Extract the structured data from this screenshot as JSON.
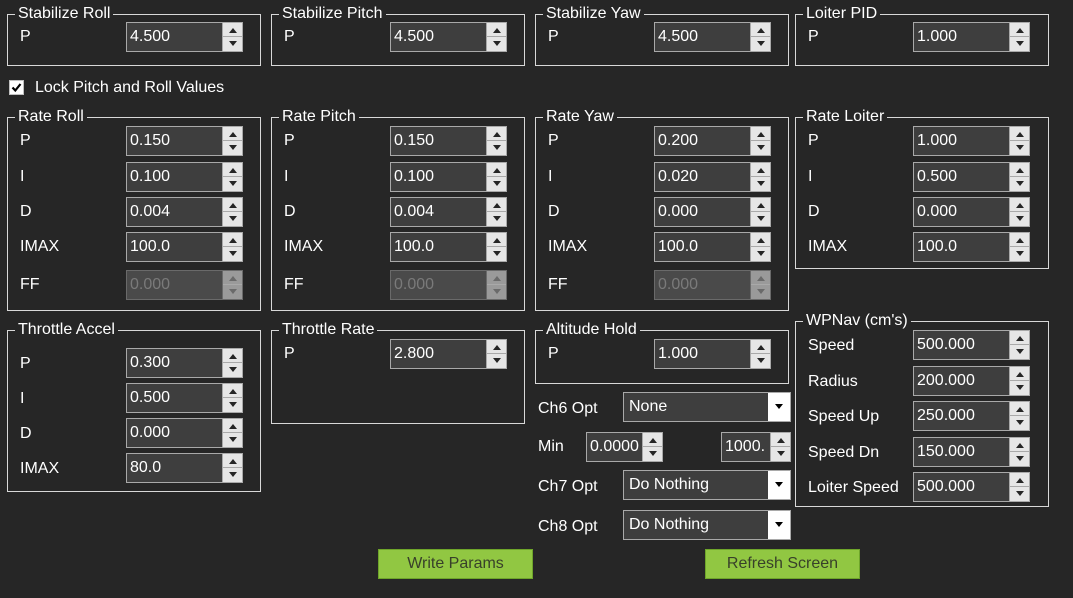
{
  "stabilize_roll": {
    "title": "Stabilize Roll",
    "p_label": "P",
    "p_value": "4.500"
  },
  "stabilize_pitch": {
    "title": "Stabilize Pitch",
    "p_label": "P",
    "p_value": "4.500"
  },
  "stabilize_yaw": {
    "title": "Stabilize Yaw",
    "p_label": "P",
    "p_value": "4.500"
  },
  "loiter_pid": {
    "title": "Loiter PID",
    "p_label": "P",
    "p_value": "1.000"
  },
  "lock_pitch_roll": {
    "label": "Lock Pitch and Roll Values",
    "checked": true
  },
  "rate_roll": {
    "title": "Rate Roll",
    "labels": {
      "p": "P",
      "i": "I",
      "d": "D",
      "imax": "IMAX",
      "ff": "FF"
    },
    "values": {
      "p": "0.150",
      "i": "0.100",
      "d": "0.004",
      "imax": "100.0",
      "ff": "0.000"
    }
  },
  "rate_pitch": {
    "title": "Rate Pitch",
    "labels": {
      "p": "P",
      "i": "I",
      "d": "D",
      "imax": "IMAX",
      "ff": "FF"
    },
    "values": {
      "p": "0.150",
      "i": "0.100",
      "d": "0.004",
      "imax": "100.0",
      "ff": "0.000"
    }
  },
  "rate_yaw": {
    "title": "Rate Yaw",
    "labels": {
      "p": "P",
      "i": "I",
      "d": "D",
      "imax": "IMAX",
      "ff": "FF"
    },
    "values": {
      "p": "0.200",
      "i": "0.020",
      "d": "0.000",
      "imax": "100.0",
      "ff": "0.000"
    }
  },
  "rate_loiter": {
    "title": "Rate Loiter",
    "labels": {
      "p": "P",
      "i": "I",
      "d": "D",
      "imax": "IMAX"
    },
    "values": {
      "p": "1.000",
      "i": "0.500",
      "d": "0.000",
      "imax": "100.0"
    }
  },
  "throttle_accel": {
    "title": "Throttle Accel",
    "labels": {
      "p": "P",
      "i": "I",
      "d": "D",
      "imax": "IMAX"
    },
    "values": {
      "p": "0.300",
      "i": "0.500",
      "d": "0.000",
      "imax": "80.0"
    }
  },
  "throttle_rate": {
    "title": "Throttle Rate",
    "p_label": "P",
    "p_value": "2.800"
  },
  "altitude_hold": {
    "title": "Altitude Hold",
    "p_label": "P",
    "p_value": "1.000"
  },
  "ch6": {
    "label": "Ch6 Opt",
    "value": "None",
    "min_label": "Min",
    "min_value": "0.0000",
    "max_value": "1000."
  },
  "ch7": {
    "label": "Ch7 Opt",
    "value": "Do Nothing"
  },
  "ch8": {
    "label": "Ch8 Opt",
    "value": "Do Nothing"
  },
  "wpnav": {
    "title": "WPNav (cm's)",
    "labels": {
      "speed": "Speed",
      "radius": "Radius",
      "speed_up": "Speed Up",
      "speed_dn": "Speed Dn",
      "loiter_speed": "Loiter Speed"
    },
    "values": {
      "speed": "500.000",
      "radius": "200.000",
      "speed_up": "250.000",
      "speed_dn": "150.000",
      "loiter_speed": "500.000"
    }
  },
  "buttons": {
    "write": "Write Params",
    "refresh": "Refresh Screen"
  },
  "colors": {
    "background": "#262626",
    "button_green": "#91c742",
    "field_bg": "#3e3e3e",
    "border": "#d8d8d8"
  }
}
